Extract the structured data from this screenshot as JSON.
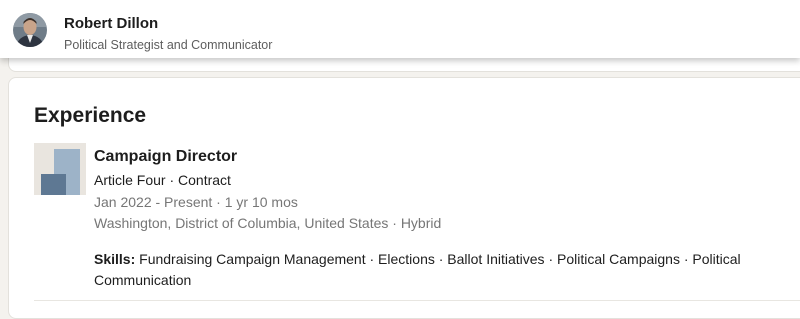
{
  "header": {
    "name": "Robert Dillon",
    "headline": "Political Strategist and Communicator",
    "avatar_icon": "profile-photo"
  },
  "experience": {
    "section_title": "Experience",
    "items": [
      {
        "logo_icon": "company-logo-placeholder",
        "title": "Campaign Director",
        "company": "Article Four · Contract",
        "dates": "Jan 2022 - Present · 1 yr 10 mos",
        "location": "Washington, District of Columbia, United States · Hybrid",
        "skills_label": "Skills:",
        "skills": " Fundraising Campaign Management · Elections · Ballot Initiatives · Political Campaigns · Political Communication"
      }
    ]
  }
}
